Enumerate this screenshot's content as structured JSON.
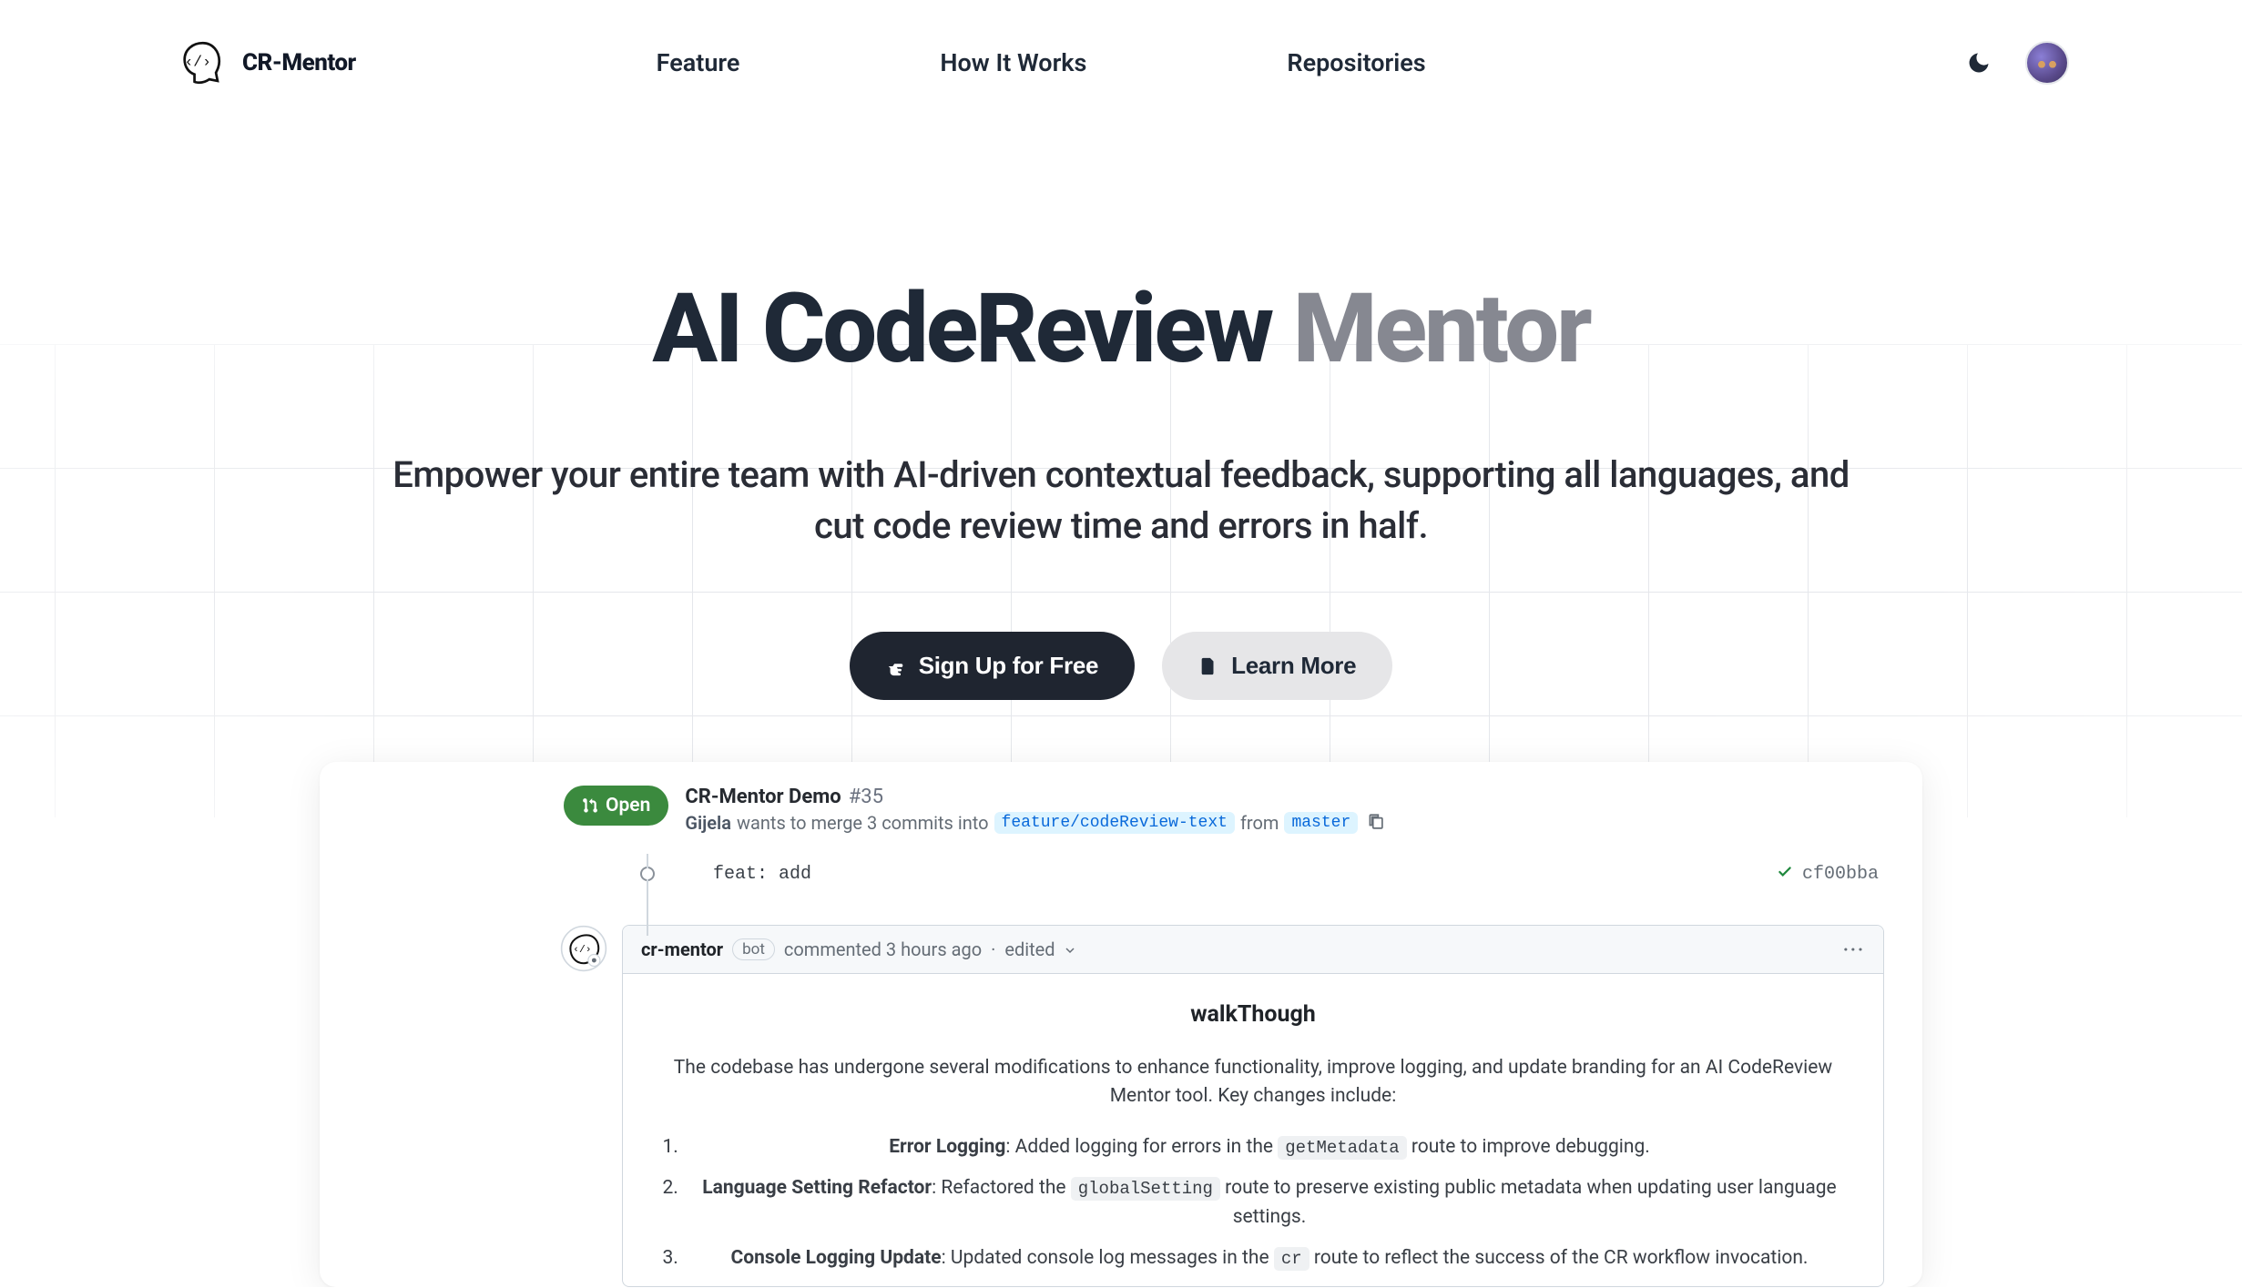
{
  "brand": "CR-Mentor",
  "nav": {
    "feature": "Feature",
    "how": "How It Works",
    "repos": "Repositories"
  },
  "hero": {
    "title_dark": "AI CodeReview",
    "title_muted": "Mentor",
    "subtitle": "Empower your entire team with AI-driven contextual feedback, supporting all languages, and cut code review time and errors in half.",
    "cta_primary": "Sign Up for Free",
    "cta_secondary": "Learn More"
  },
  "pr": {
    "open_label": "Open",
    "title": "CR-Mentor Demo",
    "number": "#35",
    "user": "Gijela",
    "meta_pre": "wants to merge 3 commits into",
    "branch_into": "feature/codeReview-text",
    "meta_from": "from",
    "branch_from": "master",
    "commit_msg": "feat: add",
    "commit_hash": "cf00bba"
  },
  "comment": {
    "author": "cr-mentor",
    "bot": "bot",
    "time": "commented 3 hours ago",
    "edited": "edited",
    "heading": "walkThough",
    "intro": "The codebase has undergone several modifications to enhance functionality, improve logging, and update branding for an AI CodeReview Mentor tool. Key changes include:",
    "items": [
      {
        "title": "Error Logging",
        "pre": ": Added logging for errors in the ",
        "code": "getMetadata",
        "post": " route to improve debugging."
      },
      {
        "title": "Language Setting Refactor",
        "pre": ": Refactored the ",
        "code": "globalSetting",
        "post": " route to preserve existing public metadata when updating user language settings."
      },
      {
        "title": "Console Logging Update",
        "pre": ": Updated console log messages in the ",
        "code": "cr",
        "post": " route to reflect the success of the CR workflow invocation."
      }
    ]
  }
}
